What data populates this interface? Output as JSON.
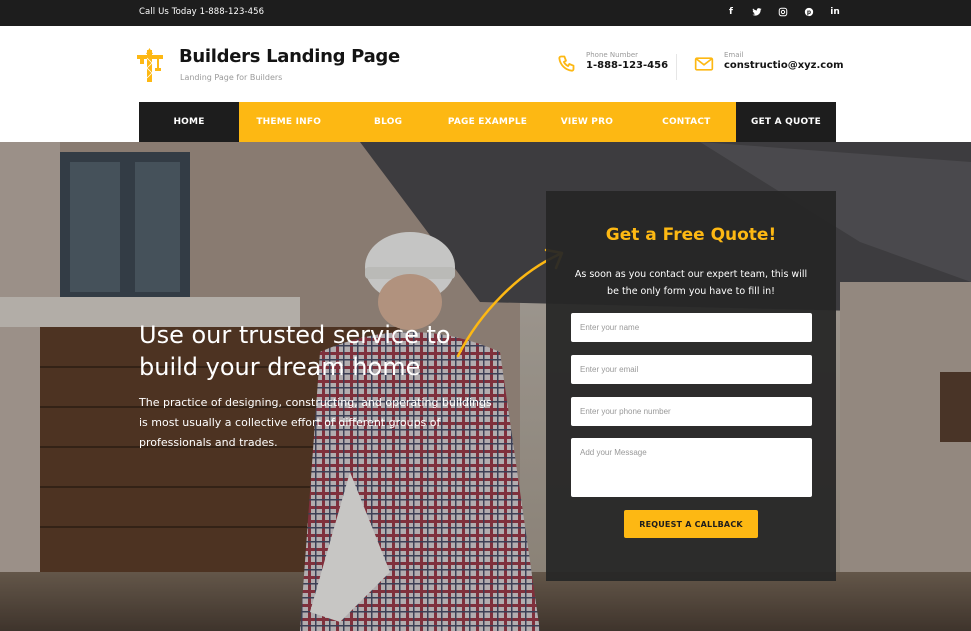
{
  "topbar": {
    "call_text": "Call Us Today  1-888-123-456",
    "social": [
      {
        "icon": "facebook-icon",
        "glyph": "f"
      },
      {
        "icon": "twitter-icon",
        "glyph": "t"
      },
      {
        "icon": "instagram-icon",
        "glyph": "ig"
      },
      {
        "icon": "pinterest-icon",
        "glyph": "p"
      },
      {
        "icon": "linkedin-icon",
        "glyph": "in"
      }
    ]
  },
  "header": {
    "site_title": "Builders Landing Page",
    "tagline": "Landing Page for Builders",
    "phone_label": "Phone Number",
    "phone_value": "1-888-123-456",
    "email_label": "Email",
    "email_value": "constructio@xyz.com"
  },
  "nav": {
    "home": "HOME",
    "items": [
      "THEME INFO",
      "BLOG",
      "PAGE EXAMPLE",
      "VIEW PRO",
      "CONTACT"
    ],
    "quote": "GET A QUOTE"
  },
  "hero": {
    "title": "Use our trusted service to build your dream home",
    "text": "The practice of designing, constructing, and operating buildings is most usually a collective effort of different groups of professionals and trades."
  },
  "quote_form": {
    "title": "Get a Free Quote!",
    "subtitle": "As soon as you contact our expert team, this will be the only form you have to fill in!",
    "name_placeholder": "Enter your name",
    "email_placeholder": "Enter your email",
    "phone_placeholder": "Enter your phone number",
    "message_placeholder": "Add your Message",
    "button": "REQUEST A CALLBACK"
  },
  "colors": {
    "accent": "#fdb813",
    "dark": "#1d1d1d"
  }
}
